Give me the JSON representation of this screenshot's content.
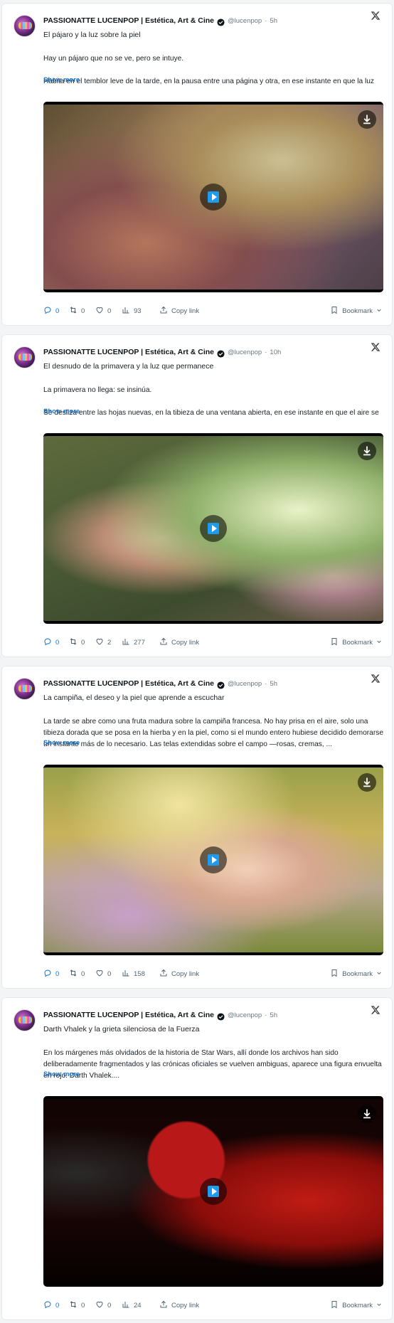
{
  "posts": [
    {
      "author": "PASSIONATTE LUCENPOP | Estética, Art & Cine",
      "handle": "@lucenpop",
      "separator": "·",
      "time": "5h",
      "title": "El pájaro y la luz sobre la piel",
      "paragraphs": [
        "Hay un pájaro que no se ve, pero se intuye.",
        "Habita en el temblor leve de la tarde, en la pausa entre una página y otra, en ese instante en que la luz"
      ],
      "show_more": "Show more",
      "replies": "0",
      "reposts": "0",
      "likes": "0",
      "views": "93",
      "copy_link": "Copy link",
      "bookmark": "Bookmark"
    },
    {
      "author": "PASSIONATTE LUCENPOP | Estética, Art & Cine",
      "handle": "@lucenpop",
      "separator": "·",
      "time": "10h",
      "title": "El desnudo de la primavera y la luz que permanece",
      "paragraphs": [
        "La primavera no llega: se insinúa.",
        "Se desliza entre las hojas nuevas, en la tibieza de una ventana abierta, en ese instante en que el aire se"
      ],
      "show_more": "Show more",
      "replies": "0",
      "reposts": "0",
      "likes": "2",
      "views": "277",
      "copy_link": "Copy link",
      "bookmark": "Bookmark"
    },
    {
      "author": "PASSIONATTE LUCENPOP | Estética, Art & Cine",
      "handle": "@lucenpop",
      "separator": "·",
      "time": "5h",
      "title": "La campiña, el deseo y la piel que aprende a escuchar",
      "paragraphs": [
        "La tarde se abre como una fruta madura sobre la campiña francesa. No hay prisa en el aire, solo una tibieza dorada que se posa en la hierba y en la piel, como si el mundo entero hubiese decidido demorarse un instante más de lo necesario. Las telas extendidas sobre el campo —rosas, cremas, ..."
      ],
      "show_more": "Show more",
      "replies": "0",
      "reposts": "0",
      "likes": "0",
      "views": "158",
      "copy_link": "Copy link",
      "bookmark": "Bookmark"
    },
    {
      "author": "PASSIONATTE LUCENPOP | Estética, Art & Cine",
      "handle": "@lucenpop",
      "separator": "·",
      "time": "5h",
      "title": "Darth Vhalek y la grieta silenciosa de la Fuerza",
      "paragraphs": [
        "En los márgenes más olvidados de la historia de Star Wars, allí donde los archivos han sido deliberadamente fragmentados y las crónicas oficiales se vuelven ambiguas, aparece una figura envuelta en rojo: Darth Vhalek...."
      ],
      "show_more": "Show more",
      "replies": "0",
      "reposts": "0",
      "likes": "0",
      "views": "24",
      "copy_link": "Copy link",
      "bookmark": "Bookmark"
    }
  ],
  "colors": {
    "accent": "#1d9bf0",
    "link": "#1d72c4",
    "muted": "#536471"
  },
  "icons": [
    "x-logo-icon",
    "verified-badge-icon",
    "reply-icon",
    "repost-icon",
    "heart-icon",
    "views-icon",
    "share-icon",
    "bookmark-icon",
    "chevron-down-icon",
    "play-icon",
    "download-icon"
  ]
}
